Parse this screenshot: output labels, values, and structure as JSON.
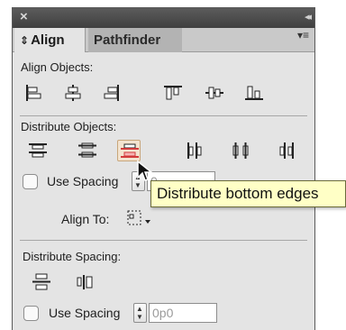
{
  "panel": {
    "close_glyph": "×",
    "collapse_glyph": "◂◂",
    "tabs": [
      {
        "label": "Align",
        "active": true
      },
      {
        "label": "Pathfinder",
        "active": false
      }
    ],
    "tab_arrows_glyph": "⇕",
    "menu_glyph": "▾≡"
  },
  "align_objects": {
    "title": "Align Objects:",
    "icons": [
      "align-left-edges-icon",
      "align-horizontal-centers-icon",
      "align-right-edges-icon",
      "align-top-edges-icon",
      "align-vertical-centers-icon",
      "align-bottom-edges-icon"
    ]
  },
  "distribute_objects": {
    "title": "Distribute Objects:",
    "icons": [
      "distribute-top-edges-icon",
      "distribute-vertical-centers-icon",
      "distribute-bottom-edges-icon",
      "distribute-left-edges-icon",
      "distribute-horizontal-centers-icon",
      "distribute-right-edges-icon"
    ],
    "hovered": "distribute-bottom-edges-icon",
    "use_spacing_label": "Use Spacing",
    "use_spacing_checked": false,
    "spacing_value": "0",
    "align_to_label": "Align To:"
  },
  "distribute_spacing": {
    "title": "Distribute Spacing:",
    "icons": [
      "distribute-vertical-space-icon",
      "distribute-horizontal-space-icon"
    ],
    "use_spacing_label": "Use Spacing",
    "use_spacing_checked": false,
    "spacing_value": "0p0"
  },
  "tooltip": {
    "text": "Distribute bottom edges"
  },
  "colors": {
    "hover_highlight": "#f3e3cf",
    "tooltip_bg": "#ffffc6",
    "accent_red": "#d23b3b"
  }
}
